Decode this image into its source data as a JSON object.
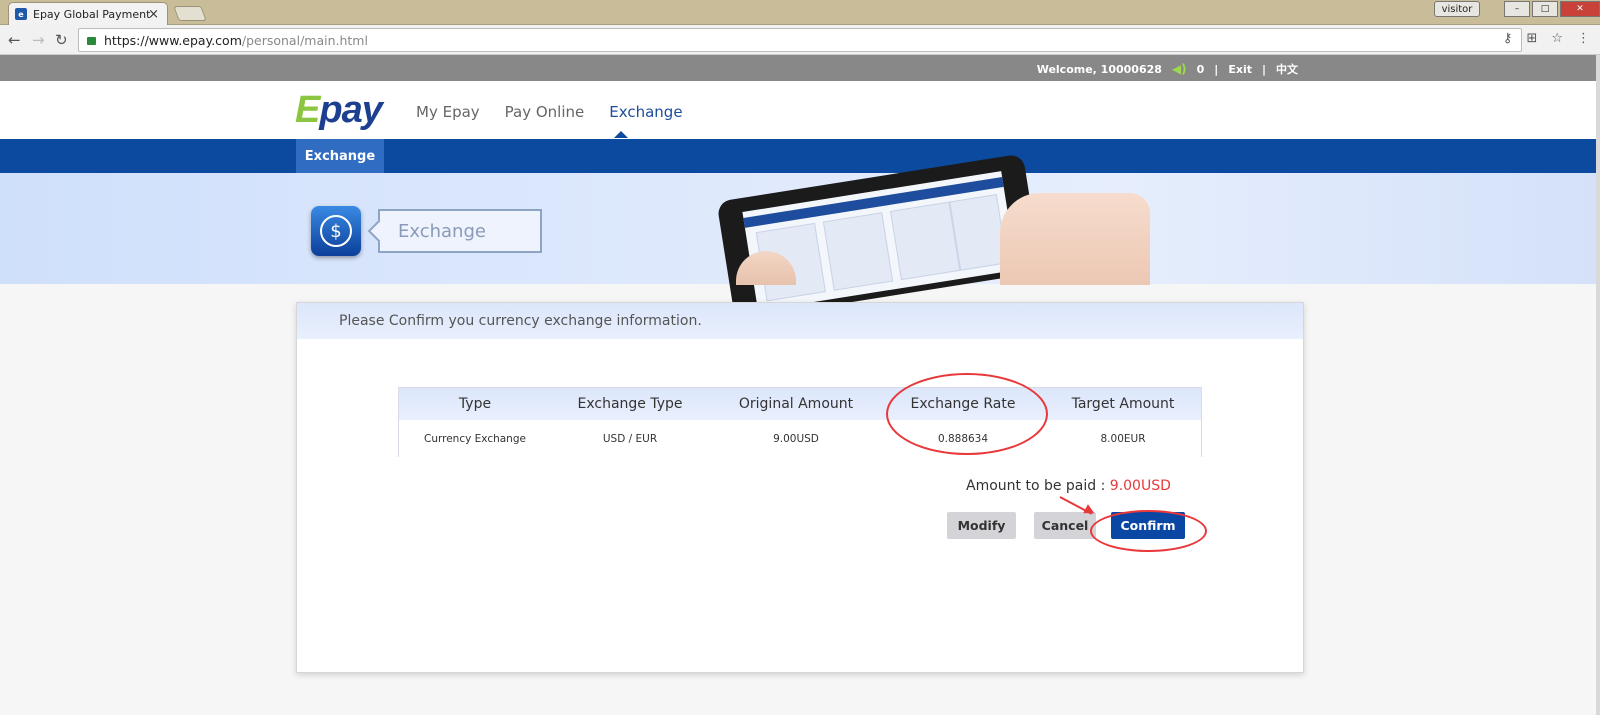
{
  "browser": {
    "tab_title": "Epay Global Payment",
    "tab_close": "×",
    "user_label": "visitor",
    "url_host": "https://www.epay.com",
    "url_path": "/personal/main.html"
  },
  "topbar": {
    "welcome": "Welcome, 10000628",
    "messages": "0",
    "exit": "Exit",
    "language": "中文",
    "separator": "|"
  },
  "header": {
    "logo_e": "E",
    "logo_rest": "pay",
    "nav": [
      "My Epay",
      "Pay Online",
      "Exchange"
    ],
    "active_nav": "Exchange"
  },
  "subnav": {
    "active_tab": "Exchange"
  },
  "banner": {
    "title": "Exchange",
    "icon": "dollar-icon"
  },
  "confirm": {
    "heading": "Please Confirm you currency exchange information.",
    "columns": [
      "Type",
      "Exchange Type",
      "Original Amount",
      "Exchange Rate",
      "Target Amount"
    ],
    "row": [
      "Currency Exchange",
      "USD / EUR",
      "9.00USD",
      "0.888634",
      "8.00EUR"
    ],
    "amount_label": "Amount to be paid : ",
    "amount_value": "9.00USD",
    "buttons": {
      "modify": "Modify",
      "cancel": "Cancel",
      "confirm": "Confirm"
    }
  },
  "colors": {
    "brand_blue": "#0b4a9e",
    "accent_green": "#8cc540",
    "highlight_red": "#e8383a"
  }
}
